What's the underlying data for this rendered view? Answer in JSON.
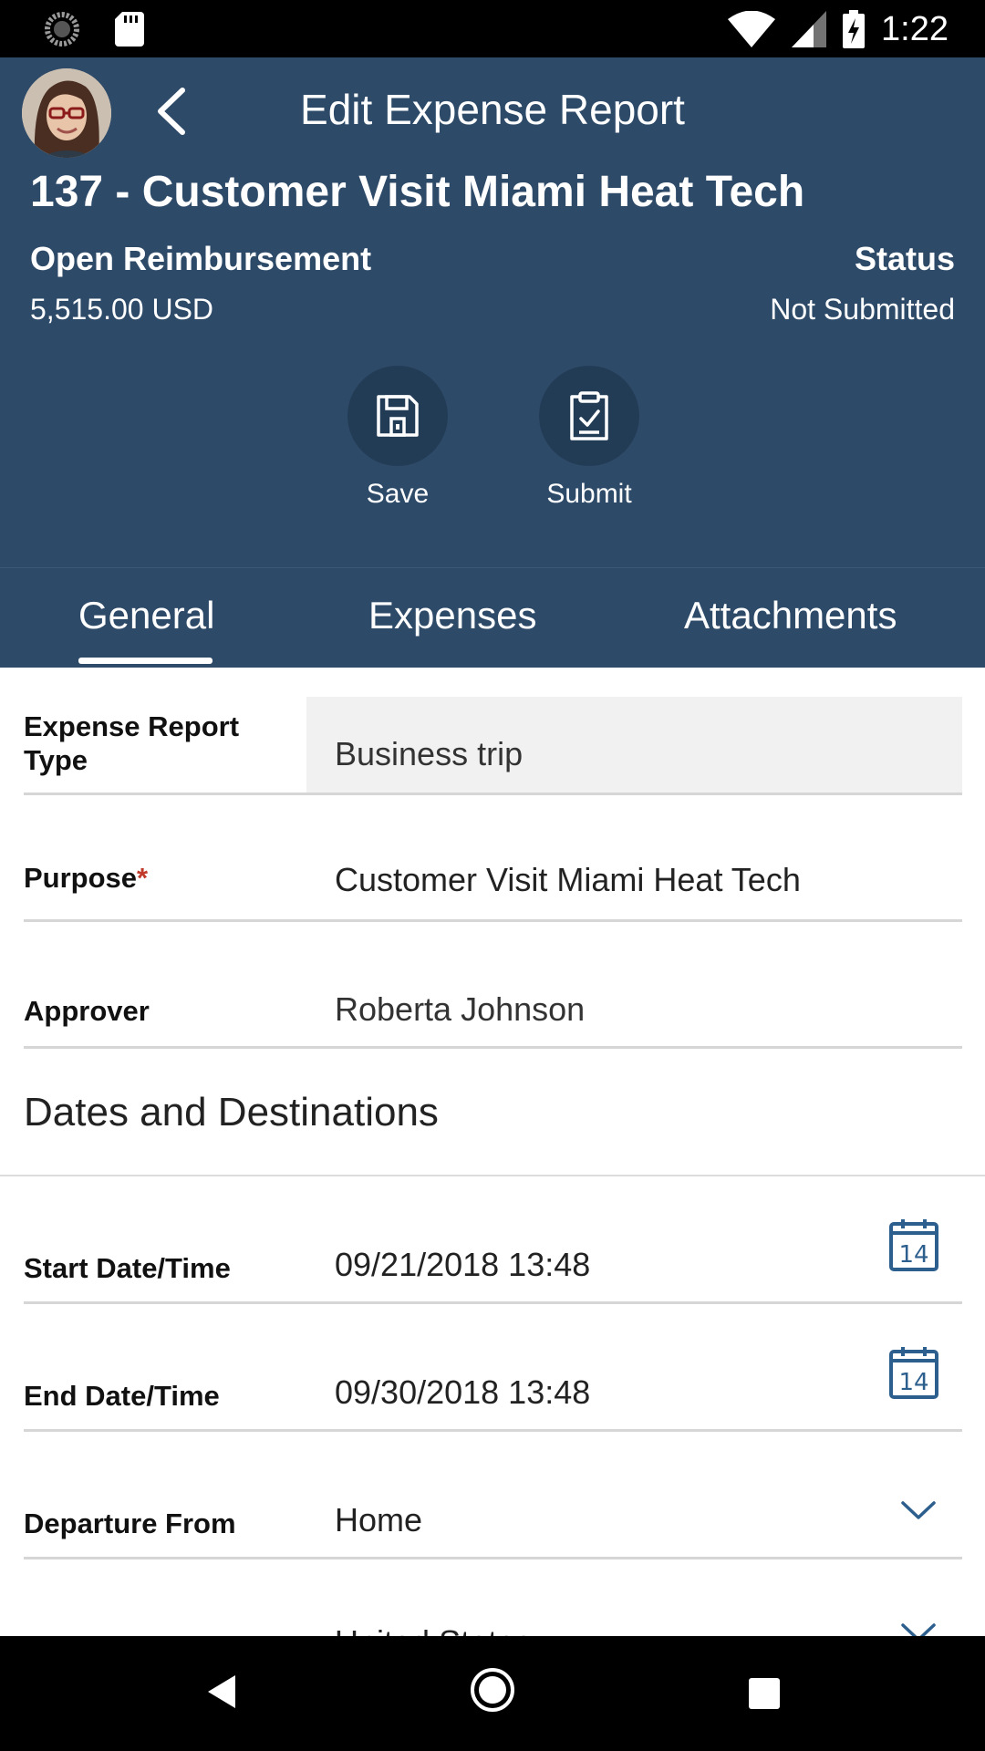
{
  "status_bar": {
    "time": "1:22",
    "icons": [
      "loading-icon",
      "sd-card-icon",
      "wifi-icon",
      "signal-icon",
      "battery-charging-icon"
    ]
  },
  "header": {
    "nav_title": "Edit Expense Report",
    "report_title": "137 - Customer Visit Miami Heat Tech",
    "reimbursement_label": "Open Reimbursement",
    "reimbursement_value": "5,515.00 USD",
    "status_label": "Status",
    "status_value": "Not Submitted",
    "actions": {
      "save": "Save",
      "submit": "Submit"
    }
  },
  "tabs": {
    "general": "General",
    "expenses": "Expenses",
    "attachments": "Attachments",
    "active": "General"
  },
  "form": {
    "type_label": "Expense Report Type",
    "type_value": "Business trip",
    "purpose_label": "Purpose",
    "purpose_required": "*",
    "purpose_value": "Customer Visit Miami Heat Tech",
    "approver_label": "Approver",
    "approver_value": "Roberta Johnson",
    "section_title": "Dates and Destinations",
    "start_label": "Start Date/Time",
    "start_value": "09/21/2018 13:48",
    "end_label": "End Date/Time",
    "end_value": "09/30/2018 13:48",
    "calendar_day": "14",
    "departure_label": "Departure From",
    "departure_value": "Home",
    "next_value_partial": "United States"
  },
  "colors": {
    "header_bg": "#2d4a68",
    "action_circle": "#233c56",
    "icon_blue": "#2d5f8e",
    "required_red": "#c0392b"
  }
}
